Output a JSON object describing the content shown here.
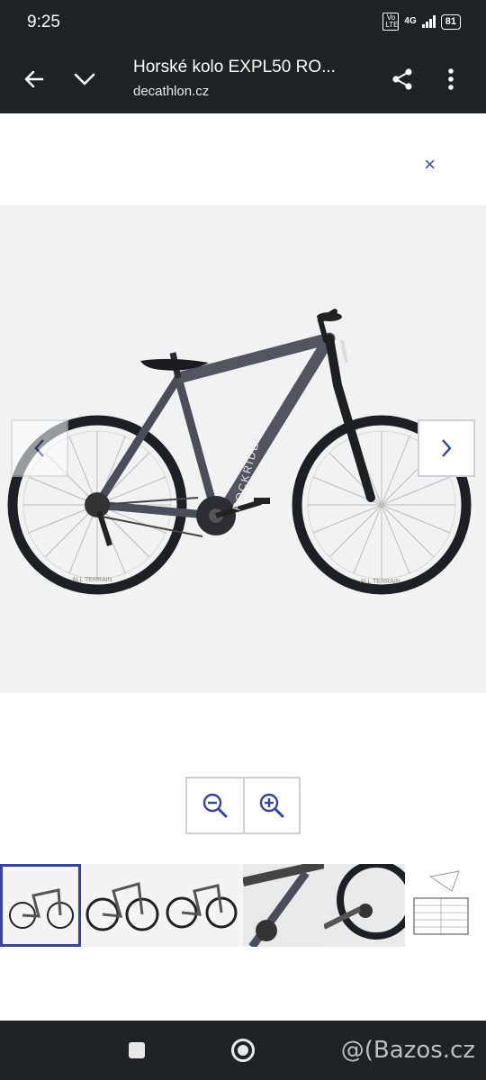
{
  "status_bar": {
    "time": "9:25",
    "volte": "Vo LTE",
    "network": "4G",
    "battery": "81"
  },
  "toolbar": {
    "title": "Horské kolo EXPL50 RO...",
    "url": "decathlon.cz",
    "back_icon": "back-arrow-icon",
    "collapse_icon": "chevron-down-icon",
    "share_icon": "share-icon",
    "menu_icon": "more-vertical-icon"
  },
  "viewer": {
    "close": "×",
    "frame_text": "ROCKRIDER",
    "tire_text": "ALL TERRAIN",
    "accent_color": "#3543a6"
  },
  "thumbnails": {
    "count": 6,
    "selected_index": 0
  },
  "watermark": "@(Bazos.cz"
}
